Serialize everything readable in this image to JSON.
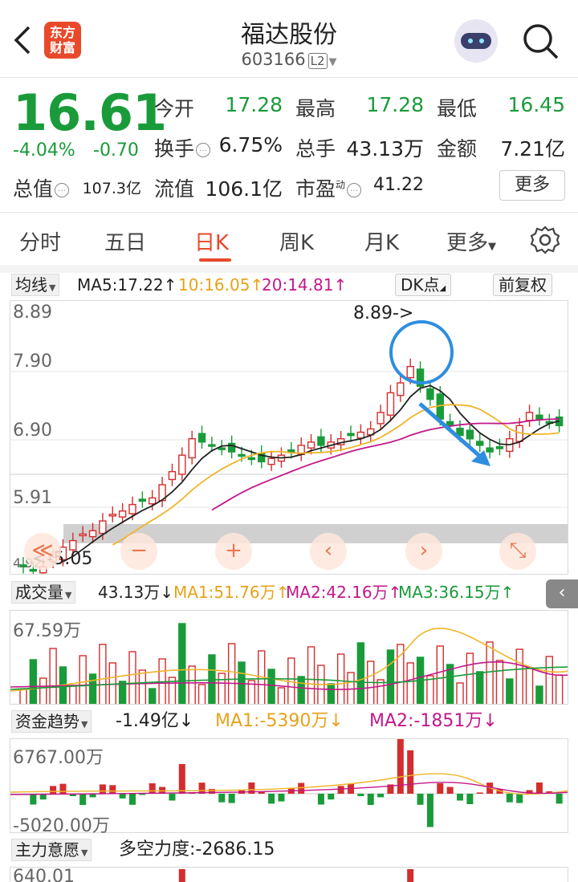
{
  "header": {
    "logo_line1": "东方",
    "logo_line2": "财富",
    "title": "福达股份",
    "code": "603166",
    "level": "L2"
  },
  "quote": {
    "price": "16.61",
    "change_pct": "-4.04%",
    "change_amt": "-0.70",
    "open_label": "今开",
    "open": "17.28",
    "high_label": "最高",
    "high": "17.28",
    "low_label": "最低",
    "low": "16.45",
    "turnover_label": "换手",
    "turnover": "6.75%",
    "volume_label": "总手",
    "volume": "43.13万",
    "amount_label": "金额",
    "amount": "7.21亿",
    "mktcap_label": "总值",
    "mktcap": "107.3亿",
    "float_label": "流值",
    "float": "106.1亿",
    "pe_label": "市盈",
    "pe_sup": "动",
    "pe": "41.22",
    "more": "更多"
  },
  "tabs": [
    "分时",
    "五日",
    "日K",
    "周K",
    "月K",
    "更多"
  ],
  "active_tab": "日K",
  "kline": {
    "selector": "均线",
    "ma5": "MA5:17.22↑",
    "ma10": "10:16.05↑",
    "ma20": "20:14.81↑",
    "dk": "DK点",
    "fq": "前复权",
    "y_labels": [
      "8.89",
      "7.90",
      "6.90",
      "5.91",
      "4.92"
    ],
    "annot_high": "8.89->",
    "annot_low": "<-5.05",
    "controls": [
      "≪",
      "−",
      "+",
      "‹",
      "›",
      "⤡"
    ]
  },
  "volume": {
    "selector": "成交量",
    "value": "43.13万↓",
    "ma1": "MA1:51.76万↑",
    "ma2": "MA2:42.16万↑",
    "ma3": "MA3:36.15万↑",
    "y_top": "67.59万"
  },
  "fund": {
    "selector": "资金趋势",
    "value": "-1.49亿↓",
    "ma1": "MA1:-5390万↓",
    "ma2": "MA2:-1851万↓",
    "y_top": "6767.00万",
    "y_bottom": "-5020.00万"
  },
  "main": {
    "selector": "主力意愿",
    "value": "多空力度:-2686.15",
    "y_top": "640.01"
  },
  "colors": {
    "up": "#d42d2d",
    "down": "#1a9b3a",
    "accent": "#e8492b",
    "ma5": "#222222",
    "ma10": "#f0b429",
    "ma20": "#c2188a",
    "arrow": "#2e8ee0"
  }
}
